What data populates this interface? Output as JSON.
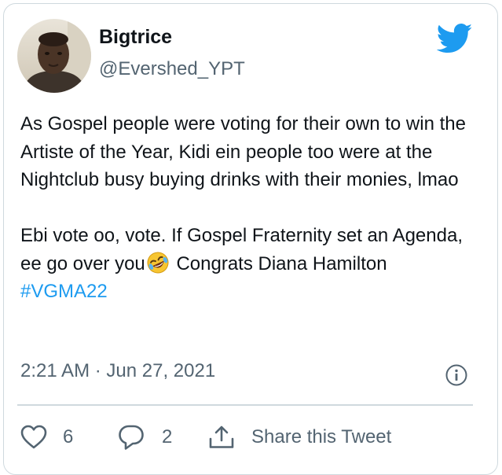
{
  "author": {
    "name": "Bigtrice",
    "handle": "@Evershed_YPT"
  },
  "tweet": {
    "line1": "As Gospel people were voting for their own to win the Artiste of the Year, Kidi ein people too were at the Nightclub busy buying drinks with their monies, lmao",
    "line2_before_emoji": " Ebi vote oo, vote. If Gospel Fraternity set an Agenda, ee go over you",
    "line2_after_emoji": "  Congrats Diana Hamilton ",
    "hashtag": "#VGMA22",
    "emoji": "rolling-on-floor-laughing-emoji"
  },
  "timestamp": "2:21 AM · Jun 27, 2021",
  "actions": {
    "like_count": "6",
    "reply_count": "2",
    "share_label": "Share this Tweet"
  },
  "icons": {
    "brand": "twitter-bird-icon",
    "info": "info-icon",
    "like": "heart-icon",
    "reply": "reply-bubble-icon",
    "share": "share-icon"
  },
  "colors": {
    "brand_blue": "#1d9bf0",
    "text_primary": "#0f1419",
    "text_secondary": "#536471",
    "border": "#cfd9de"
  }
}
